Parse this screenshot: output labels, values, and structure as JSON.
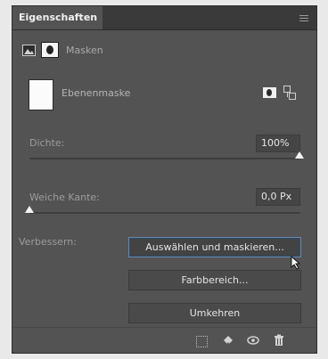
{
  "panel": {
    "tab_title": "Eigenschaften",
    "subheader_label": "Masken",
    "layer_name": "Ebenenmaske"
  },
  "density": {
    "label": "Dichte:",
    "value": "100%",
    "level_percent": 100
  },
  "feather": {
    "label": "Weiche Kante:",
    "value": "0,0 Px",
    "level_percent": 0
  },
  "refine": {
    "label": "Verbessern:",
    "buttons": {
      "select_and_mask": "Auswählen und maskieren...",
      "color_range": "Farbbereich...",
      "invert": "Umkehren"
    }
  },
  "icons": {
    "panel_menu": "panel-menu-icon",
    "pixel_mask": "pixel-mask-icon",
    "vector_mask": "vector-mask-icon",
    "load_selection": "load-selection-icon",
    "apply_mask": "apply-mask-icon",
    "visibility": "eye-icon",
    "delete": "trash-icon"
  },
  "colors": {
    "panel_bg": "#535353",
    "focus_border": "#6b87a8"
  }
}
